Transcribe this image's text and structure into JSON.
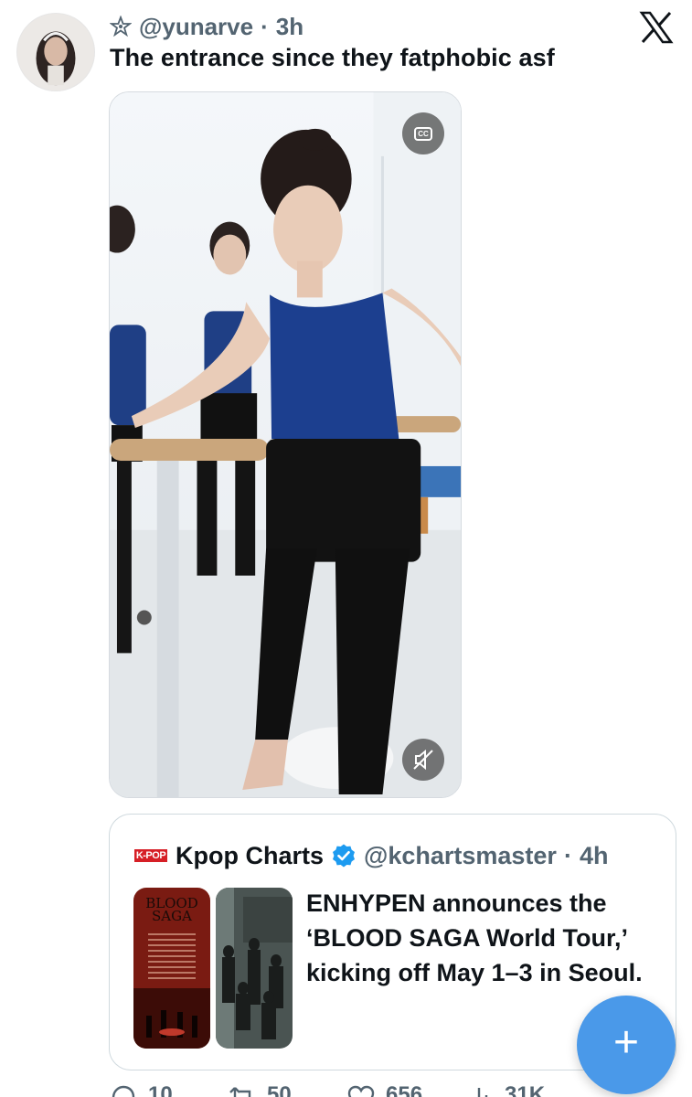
{
  "tweet": {
    "handle": "@yunarve",
    "separator": "·",
    "time": "3h",
    "text": "The entrance since they fatphobic asf",
    "icons": {
      "badge": "star-icon",
      "close": "x-logo-icon"
    }
  },
  "media": {
    "cc_label": "CC",
    "icons": {
      "captions": "captions-icon",
      "mute": "mute-icon"
    }
  },
  "quote": {
    "logo_label": "K-POP",
    "name": "Kpop Charts",
    "handle": "@kchartsmaster",
    "separator": "·",
    "time": "4h",
    "text": "ENHYPEN announces the ‘BLOOD SAGA World Tour,’ kicking off May 1–3 in Seoul.",
    "poster_title_1": "BLOOD",
    "poster_title_2": "SAGA",
    "colors": {
      "verified": "#1d9bf0"
    }
  },
  "actions": {
    "reply_count": "10",
    "retweet_count": "50",
    "like_count": "656",
    "views_count": "31K"
  },
  "fab": {
    "label": "+",
    "color": "#4a99e9"
  }
}
